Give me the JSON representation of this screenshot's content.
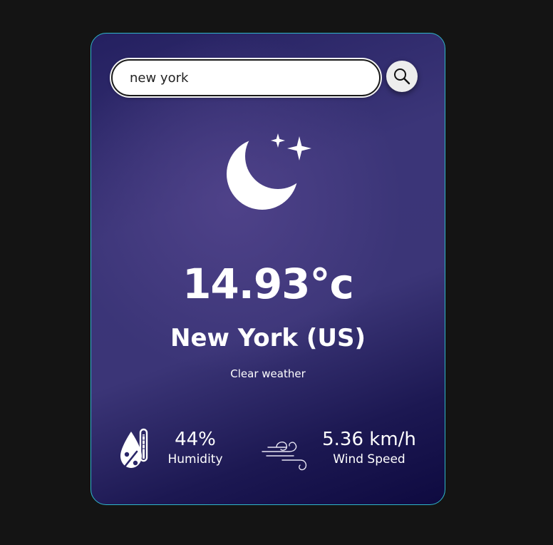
{
  "search": {
    "value": "new york",
    "icon": "search-icon"
  },
  "weather": {
    "icon": "moon-stars-icon",
    "temperature": "14.93°c",
    "city": "New York (US)",
    "description": "Clear weather"
  },
  "humidity": {
    "icon": "humidity-icon",
    "value": "44%",
    "label": "Humidity"
  },
  "wind": {
    "icon": "wind-icon",
    "value": "5.36 km/h",
    "label": "Wind Speed"
  },
  "colors": {
    "page_background": "#141414",
    "card_border": "#2fb6c8",
    "card_gradient_start": "#242060",
    "card_gradient_mid": "#3b3578",
    "card_gradient_end": "#0e0a40",
    "text": "#ffffff"
  }
}
